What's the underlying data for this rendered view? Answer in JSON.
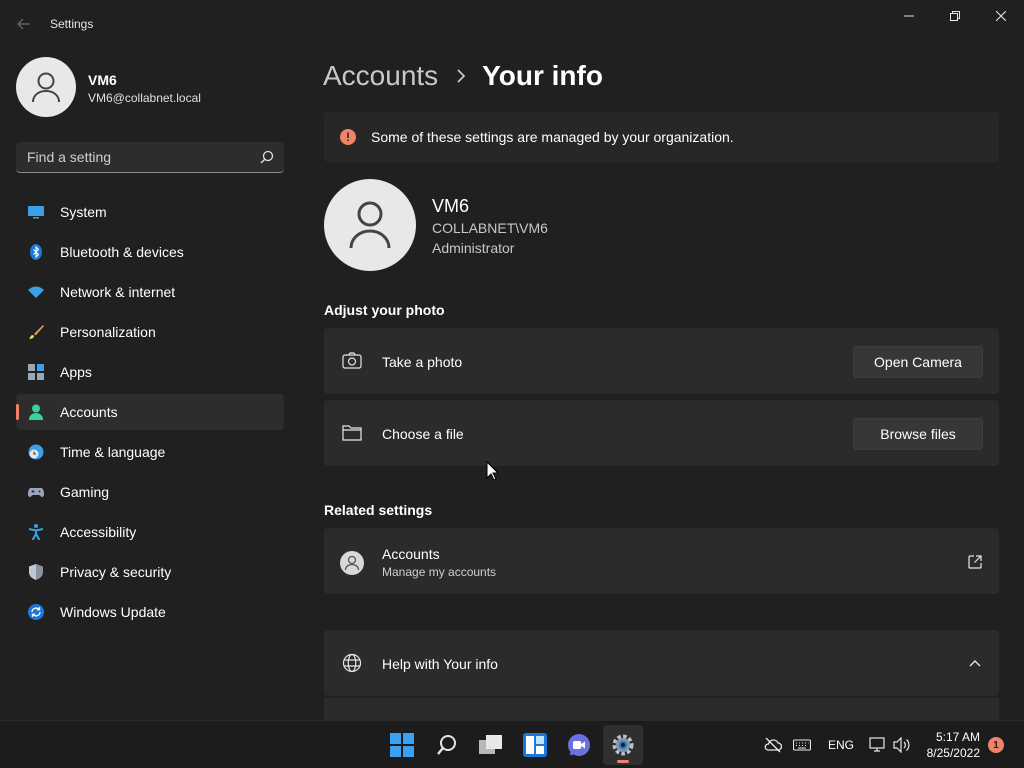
{
  "window": {
    "title": "Settings"
  },
  "profile": {
    "name": "VM6",
    "email": "VM6@collabnet.local"
  },
  "search": {
    "placeholder": "Find a setting"
  },
  "sidebar": {
    "items": [
      {
        "label": "System",
        "icon": "monitor-icon"
      },
      {
        "label": "Bluetooth & devices",
        "icon": "bluetooth-icon"
      },
      {
        "label": "Network & internet",
        "icon": "wifi-icon"
      },
      {
        "label": "Personalization",
        "icon": "brush-icon"
      },
      {
        "label": "Apps",
        "icon": "apps-icon"
      },
      {
        "label": "Accounts",
        "icon": "person-icon",
        "active": true
      },
      {
        "label": "Time & language",
        "icon": "globe-clock-icon"
      },
      {
        "label": "Gaming",
        "icon": "gamepad-icon"
      },
      {
        "label": "Accessibility",
        "icon": "accessibility-icon"
      },
      {
        "label": "Privacy & security",
        "icon": "shield-icon"
      },
      {
        "label": "Windows Update",
        "icon": "sync-icon"
      }
    ]
  },
  "breadcrumb": {
    "parent": "Accounts",
    "current": "Your info"
  },
  "info_bar": {
    "text": "Some of these settings are managed by your organization."
  },
  "user": {
    "name": "VM6",
    "domain": "COLLABNET\\VM6",
    "role": "Administrator"
  },
  "adjust_photo": {
    "title": "Adjust your photo",
    "take_photo": {
      "label": "Take a photo",
      "button": "Open Camera"
    },
    "choose_file": {
      "label": "Choose a file",
      "button": "Browse files"
    }
  },
  "related": {
    "title": "Related settings",
    "accounts": {
      "label": "Accounts",
      "sublabel": "Manage my accounts"
    }
  },
  "help": {
    "label": "Help with Your info"
  },
  "taskbar": {
    "lang": "ENG",
    "time": "5:17 AM",
    "date": "8/25/2022",
    "badge": "1"
  },
  "colors": {
    "accent": "#f0826a",
    "background": "#202020",
    "card": "#2b2b2b"
  }
}
